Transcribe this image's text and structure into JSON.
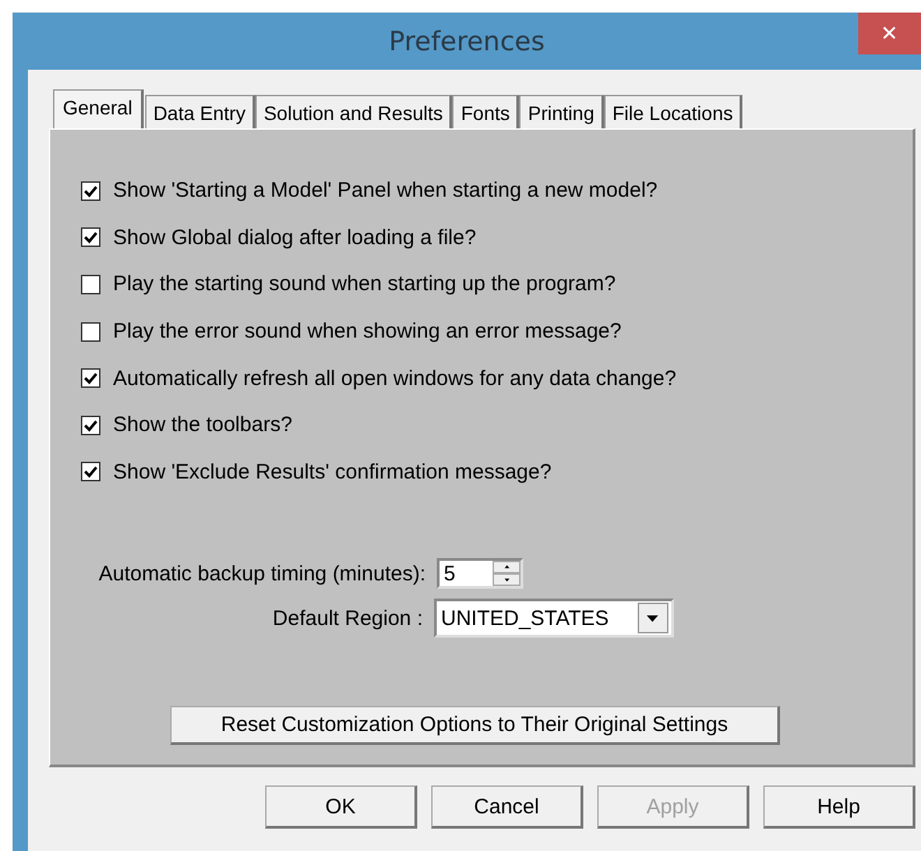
{
  "window": {
    "title": "Preferences",
    "close": "✕"
  },
  "tabs": [
    {
      "label": "General",
      "selected": true
    },
    {
      "label": "Data Entry",
      "selected": false
    },
    {
      "label": "Solution and Results",
      "selected": false
    },
    {
      "label": "Fonts",
      "selected": false
    },
    {
      "label": "Printing",
      "selected": false
    },
    {
      "label": "File Locations",
      "selected": false
    }
  ],
  "options": [
    {
      "label": "Show 'Starting a Model' Panel when starting a new model?",
      "checked": true
    },
    {
      "label": "Show Global dialog after loading a file?",
      "checked": true
    },
    {
      "label": "Play the starting sound when starting up the program?",
      "checked": false
    },
    {
      "label": "Play the error sound when showing an error message?",
      "checked": false
    },
    {
      "label": "Automatically refresh all open windows for any data change?",
      "checked": true
    },
    {
      "label": "Show the toolbars?",
      "checked": true
    },
    {
      "label": "Show 'Exclude Results' confirmation message?",
      "checked": true
    }
  ],
  "backup": {
    "label": "Automatic backup timing (minutes):",
    "value": "5"
  },
  "region": {
    "label": "Default Region :",
    "value": "UNITED_STATES"
  },
  "reset_button": "Reset Customization Options to Their Original Settings",
  "buttons": [
    {
      "label": "OK",
      "disabled": false
    },
    {
      "label": "Cancel",
      "disabled": false
    },
    {
      "label": "Apply",
      "disabled": true
    },
    {
      "label": "Help",
      "disabled": false
    }
  ]
}
